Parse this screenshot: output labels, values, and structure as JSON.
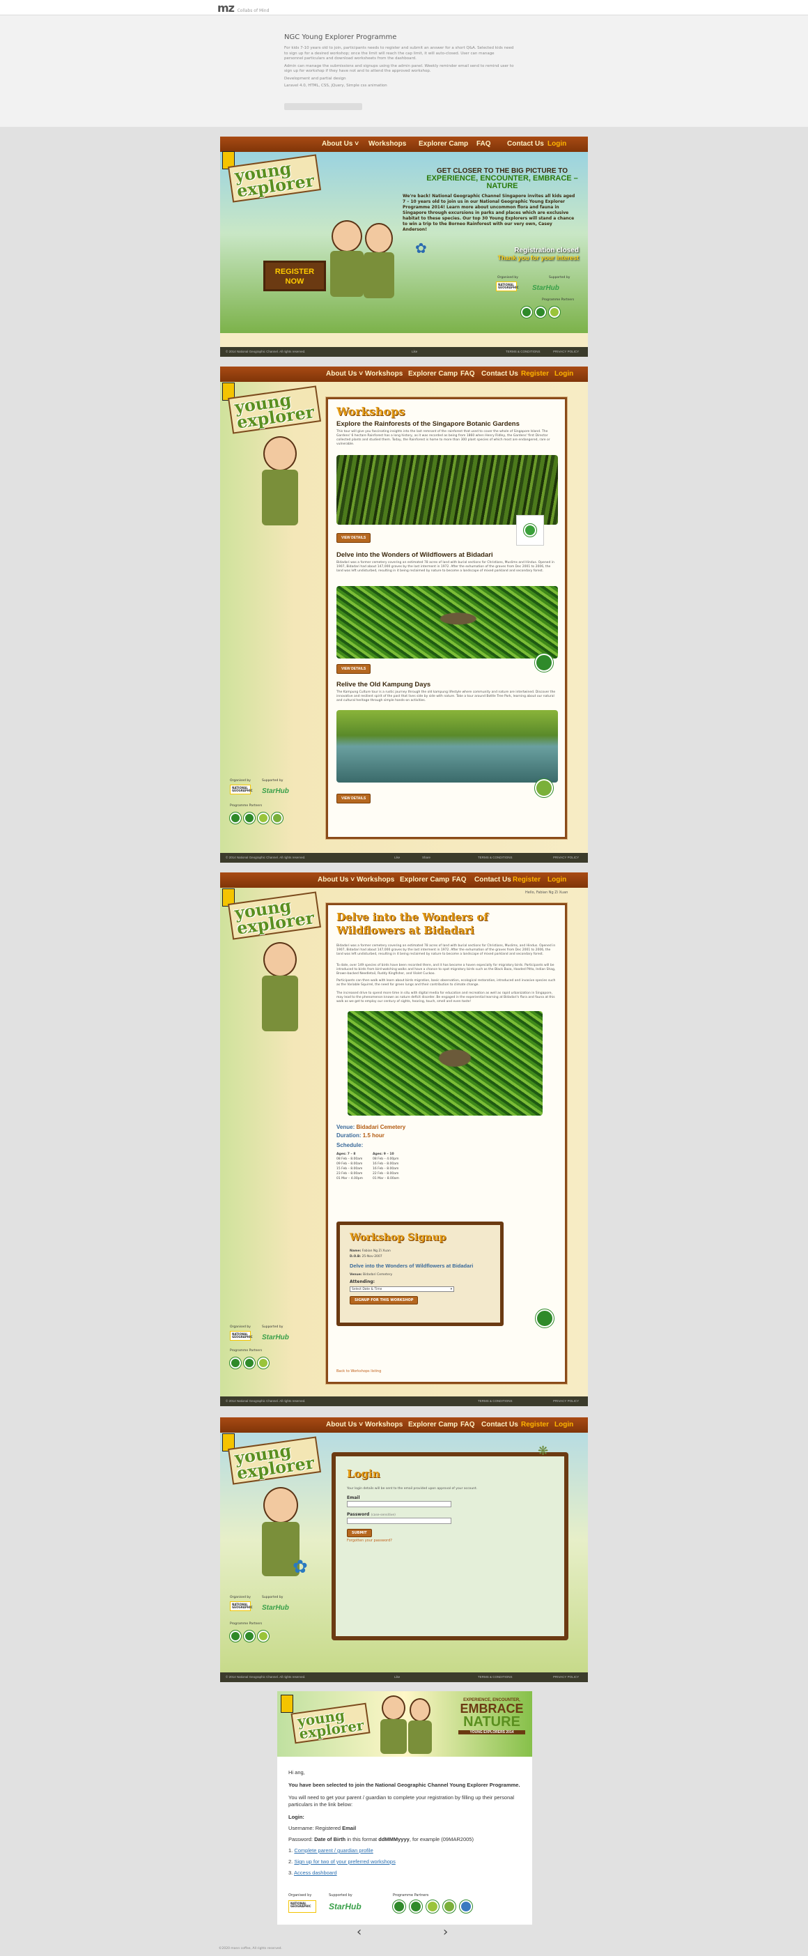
{
  "topbar": {
    "logo": "mz",
    "logo_sub": "Collabs of Mind"
  },
  "project": {
    "title": "NGC Young Explorer Programme",
    "description": "For kids 7-10 years old to join, participants needs to register and submit an answer for a short Q&A. Selected kids need to sign up for a desired workshop; once the limit will reach the cap limit, it will auto-closed. User can manage personnel particulars and download worksheets from the dashboard.",
    "description2": "Admin can manage the submissions and signups using the admin panel. Weekly reminder email send to remind user to sign up for workshop if they have not and to attend the approved workshop.",
    "role": "Development and partial design",
    "tech": "Laravel 4.0, HTML, CSS, jQuery, Simple css animation"
  },
  "nav": {
    "about": "About Us ˅",
    "workshops": "Workshops",
    "camp": "Explorer Camp",
    "faq": "FAQ",
    "contact": "Contact Us",
    "register": "Register",
    "login": "Login"
  },
  "brand": {
    "line1": "young",
    "line2": "explorer",
    "ngc": "NATIONAL GEOGRAPHIC"
  },
  "hero": {
    "headline1": "GET CLOSER TO THE BIG PICTURE TO",
    "headline2": "EXPERIENCE, ENCOUNTER, EMBRACE – NATURE",
    "text": "We're back! National Geographic Channel Singapore invites all kids aged 7 – 10 years old to join us in our National Geographic Young Explorer Programme 2014! Learn more about uncommon flora and fauna in Singapore through excursions in parks and places which are exclusive habitat to these species. Our top 30 Young Explorers will stand a chance to win a trip to the Borneo Rainforest with our very own, Casey Anderson!",
    "reg_closed": "Registration closed",
    "thank_you": "Thank you for your interest",
    "register_board": "REGISTER NOW",
    "organised_by": "Organised by",
    "supported_by": "Supported by",
    "partners": "Programme Partners"
  },
  "footer": {
    "copyright": "© 2014 National Geographic Channel. All rights reserved.",
    "terms": "TERMS & CONDITIONS",
    "contest_terms": "WEBSITE TERMS OF USE",
    "privacy": "PRIVACY POLICY",
    "like": "Like",
    "share": "Share"
  },
  "workshops": {
    "heading": "Workshops",
    "items": [
      {
        "title": "Explore the Rainforests of the Singapore Botanic Gardens",
        "text": "This tour will give you fascinating insights into the last remnant of the rainforest that used to cover the whole of Singapore Island. The Gardens' 6 hectare Rainforest has a long history, as it was recorded as being from 1860 when Henry Ridley, the Gardens' first Director collected plants and studied them. Today, the Rainforest is home to more than 300 plant species of which most are endangered, rare or vulnerable.",
        "button": "VIEW DETAILS",
        "partner": "NATIONAL PARKS"
      },
      {
        "title": "Delve into the Wonders of Wildflowers at Bidadari",
        "text": "Bidadari was a former cemetery covering an estimated 78 acres of land with burial sections for Christians, Muslims and Hindus. Opened in 1907, Bidadari had about 147,000 graves by the last interment in 1972. After the exhumation of the graves from Dec 2001 to 2006, the land was left undisturbed, resulting in it being reclaimed by nature to become a landscape of mixed parkland and secondary forest.",
        "button": "VIEW DETAILS",
        "partner": "Nature Society (Singapore)"
      },
      {
        "title": "Relive the Old Kampung Days",
        "text": "The Kampung Culture tour is a rustic journey through the old kampung lifestyle where community and nature are intertwined. Discover the innovative and resilient spirit of the past that lives side by side with nature. Take a tour around Bottle Tree Park, learning about our natural and cultural heritage through simple hands-on activities.",
        "button": "VIEW DETAILS",
        "partner": "ground-up"
      }
    ]
  },
  "detail": {
    "greeting": "Hello, Fabian Ng Zi Xuan",
    "title": "Delve into the Wonders of Wildflowers at Bidadari",
    "para1": "Bidadari was a former cemetery covering an estimated 78 acres of land with burial sections for Christians, Muslims, and Hindus. Opened in 1907, Bidadari had about 147,000 graves by the last interment in 1972. After the exhumation of the graves from Dec 2001 to 2006, the land was left undisturbed, resulting in it being reclaimed by nature to become a landscape of mixed parkland and secondary forest.",
    "para2": "To date, over 149 species of birds have been recorded there, and it has become a haven especially for migratory birds. Participants will be introduced to birds from bird-watching walks and have a chance to spot migratory birds such as the Black Baza, Hooded Pitta, Indian Shag, Brown-backed Needletail, Ruddy Kingfisher, and Violet Cuckoo.",
    "para3": "Participants can then walk with learn about birds migration, basic observation, ecological restoration, introduced and invasive species such as the Variable Squirrel, the need for green lungs and their contribution to climate change.",
    "para4": "The increased drive to spend more time in situ with digital media for education and recreation as well as rapid urbanization in Singapore, may lead to the phenomenon known as nature deficit disorder. Be engaged in the experiential learning at Bidadari's flora and fauna at this walk as we get to employ our century of sights, hearing, touch, smell and even taste!",
    "venue_label": "Venue:",
    "venue": "Bidadari Cemetery",
    "duration_label": "Duration:",
    "duration": "1.5 hour",
    "schedule_label": "Schedule:",
    "col1_head": "Ages: 7 – 8",
    "col2_head": "Ages: 9 – 10",
    "col1": [
      "08 Feb – 8.00am",
      "09 Feb – 8.00am",
      "15 Feb – 8.00am",
      "23 Feb – 8.00am",
      "01 Mar – 4.00pm"
    ],
    "col2": [
      "08 Feb – 4.00pm",
      "16 Feb – 8.00am",
      "16 Feb – 8.00am",
      "22 Feb – 8.00am",
      "01 Mar – 8.00am"
    ],
    "signup_heading": "Workshop Signup",
    "name_label": "Name:",
    "name": "Fabian Ng Zi Xuan",
    "dob_label": "D.O.B:",
    "dob": "25-Nov-2007",
    "signup_title": "Delve into the Wonders of Wildflowers at Bidadari",
    "signup_venue_label": "Venue:",
    "signup_venue": "Bidadari Cemetery",
    "attending_label": "Attending:",
    "select_placeholder": "Select Date & Time",
    "signup_button": "SIGNUP FOR THIS WORKSHOP",
    "back_link": "Back to Workshops listing"
  },
  "login": {
    "heading": "Login",
    "instructions": "Your login details will be sent to the email provided upon approval of your account.",
    "email_label": "Email",
    "password_label": "Password",
    "password_hint": "(case-sensitive)",
    "submit": "SUBMIT",
    "forgot": "Forgotten your password?"
  },
  "email": {
    "banner1": "EXPERIENCE, ENCOUNTER,",
    "banner2": "EMBRACE",
    "banner3": "NATURE",
    "banner4": "YOUNG EXPLORERS 2014",
    "greeting": "Hi ang,",
    "selected": "You have been selected to join the National Geographic Channel Young Explorer Programme.",
    "instruction": "You will need to get your parent / guardian to complete your registration by filling up their personal particulars in the link below:",
    "login_label": "Login:",
    "username_text": "Username: Registered",
    "username_bold": "Email",
    "password_text": "Password:",
    "password_bold": "Date of Birth",
    "password_format": "in this format",
    "password_format_bold": "ddMMMyyyy",
    "password_example": ", for example (09MAR2005)",
    "steps": [
      "Complete parent / guardian profile",
      "Sign up for two of your preferred workshops",
      "Access dashboard"
    ],
    "organised_by": "Organised by",
    "supported_by": "Supported by",
    "partners": "Programme Partners"
  },
  "pager": {
    "prev": "‹",
    "next": "›"
  },
  "page_copyright": "©2020 mann coffee, All rights reserved."
}
